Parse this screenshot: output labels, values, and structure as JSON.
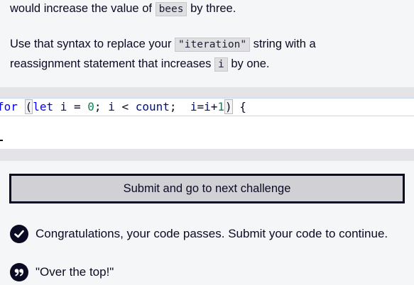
{
  "instructions": {
    "line1_prefix": "would increase the value of",
    "line1_code": "bees",
    "line1_suffix": "by three.",
    "line2_prefix": "Use that syntax to replace your",
    "line2_code": "\"iteration\"",
    "line2_suffix": "string with a",
    "line3_prefix": "reassignment statement that increases",
    "line3_code": "i",
    "line3_suffix": "by one."
  },
  "editor": {
    "tokens": {
      "kw_for": "for",
      "open_paren": "(",
      "kw_let": "let",
      "var_i1": "i",
      "eq": " = ",
      "zero": "0",
      "semi1": "; ",
      "var_i2": "i",
      "lt": " < ",
      "count": "count",
      "semi2": ";  ",
      "assign_lhs": "i",
      "assign_eq": "=",
      "assign_rhs": "i",
      "plus": "+",
      "one": "1",
      "close_paren": ")",
      "brace": " {"
    }
  },
  "submit_button": {
    "label": "Submit and go to next challenge"
  },
  "messages": {
    "pass": "Congratulations, your code passes. Submit your code to continue.",
    "quote": "\"Over the top!\""
  },
  "icons": {
    "pass": "checkmark-circle-icon",
    "quote": "quote-icon"
  },
  "colors": {
    "background": "#f5f6f7",
    "text": "#0a0a23",
    "button_bg": "#d0d0d5",
    "keyword": "#0000ff",
    "number": "#098658",
    "identifier": "#001080"
  }
}
